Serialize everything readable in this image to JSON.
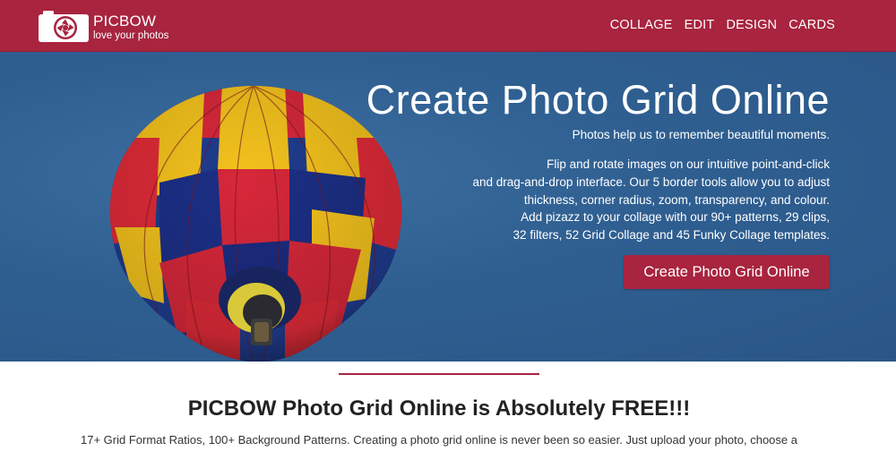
{
  "brand": {
    "name": "PICBOW",
    "tagline": "love your photos",
    "color": "#a8243f"
  },
  "nav": {
    "items": [
      "COLLAGE",
      "EDIT",
      "DESIGN",
      "CARDS"
    ]
  },
  "hero": {
    "title": "Create Photo Grid Online",
    "subtitle": "Photos help us to remember beautiful moments.",
    "description_lines": [
      "Flip and rotate images on our intuitive point-and-click",
      "and drag-and-drop interface. Our 5 border tools allow you to adjust",
      "thickness, corner radius, zoom, transparency, and colour.",
      "Add pizazz to your collage with our 90+ patterns, 29 clips,",
      "32 filters, 52 Grid Collage and 45 Funky Collage templates."
    ],
    "cta_label": "Create Photo Grid Online",
    "background_color": "#2f5f91"
  },
  "section": {
    "title_prefix": "PICBOW Photo Grid Online is",
    "title_emphasis": "Absolutely",
    "title_suffix": "FREE!!!",
    "text": "17+ Grid Format Ratios, 100+ Background Patterns. Creating a photo grid online is never been so easier. Just upload your photo, choose a"
  },
  "icons": {
    "logo": "camera-aperture-logo-icon"
  }
}
